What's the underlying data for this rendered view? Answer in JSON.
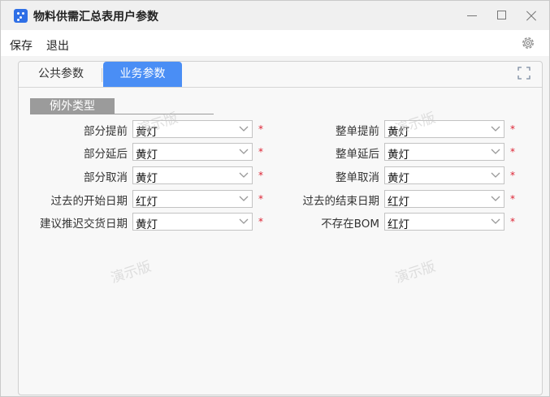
{
  "window": {
    "title": "物料供需汇总表用户参数"
  },
  "menu": {
    "save": "保存",
    "exit": "退出"
  },
  "tabs": {
    "public": "公共参数",
    "business": "业务参数"
  },
  "section": {
    "title": "例外类型"
  },
  "fields": [
    {
      "label": "部分提前",
      "value": "黄灯",
      "required": "*"
    },
    {
      "label": "部分延后",
      "value": "黄灯",
      "required": "*"
    },
    {
      "label": "部分取消",
      "value": "黄灯",
      "required": "*"
    },
    {
      "label": "过去的开始日期",
      "value": "红灯",
      "required": "*"
    },
    {
      "label": "建议推迟交货日期",
      "value": "黄灯",
      "required": "*"
    },
    {
      "label": "整单提前",
      "value": "黄灯",
      "required": "*"
    },
    {
      "label": "整单延后",
      "value": "黄灯",
      "required": "*"
    },
    {
      "label": "整单取消",
      "value": "黄灯",
      "required": "*"
    },
    {
      "label": "过去的结束日期",
      "value": "红灯",
      "required": "*"
    },
    {
      "label": "不存在BOM",
      "value": "红灯",
      "required": "*"
    }
  ],
  "watermark": "演示版",
  "colors": {
    "accent": "#4a8ef5",
    "required": "#dd2233",
    "section": "#9b9b9b"
  },
  "icons": {
    "app": "app-icon",
    "settings": "gear-icon",
    "expand": "expand-icon",
    "dropdown": "chevron-down-icon"
  }
}
